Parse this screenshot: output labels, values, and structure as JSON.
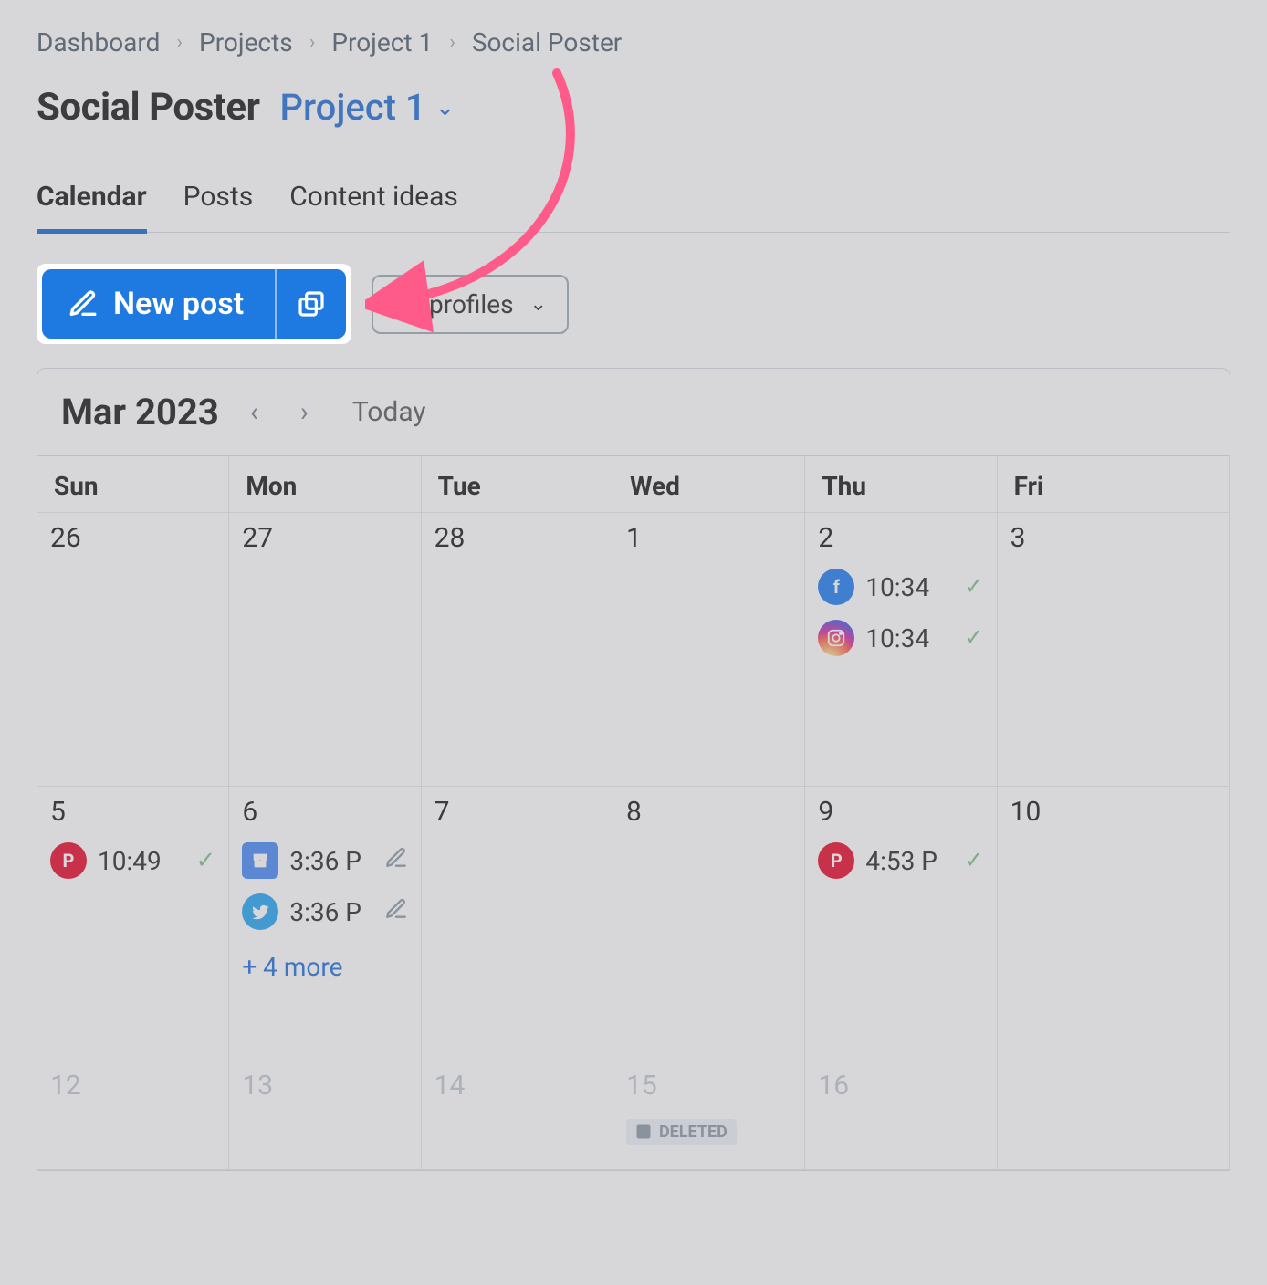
{
  "breadcrumb": {
    "items": [
      "Dashboard",
      "Projects",
      "Project 1",
      "Social Poster"
    ]
  },
  "header": {
    "title": "Social Poster",
    "project_selector_label": "Project 1"
  },
  "tabs": {
    "items": [
      "Calendar",
      "Posts",
      "Content ideas"
    ],
    "active_index": 0
  },
  "toolbar": {
    "new_post_label": "New post",
    "profiles_filter_label": "All profiles"
  },
  "calendar": {
    "month_label": "Mar 2023",
    "today_label": "Today",
    "day_headers": [
      "Sun",
      "Mon",
      "Tue",
      "Wed",
      "Thu",
      "Fri"
    ],
    "rows": [
      {
        "cells": [
          {
            "num": "26",
            "events": []
          },
          {
            "num": "27",
            "events": []
          },
          {
            "num": "28",
            "events": []
          },
          {
            "num": "1",
            "events": []
          },
          {
            "num": "2",
            "events": [
              {
                "network": "facebook",
                "time": "10:34",
                "status": "done"
              },
              {
                "network": "instagram",
                "time": "10:34",
                "status": "done"
              }
            ]
          },
          {
            "num": "3",
            "events": []
          }
        ]
      },
      {
        "cells": [
          {
            "num": "5",
            "events": [
              {
                "network": "pinterest",
                "time": "10:49",
                "status": "done"
              }
            ]
          },
          {
            "num": "6",
            "events": [
              {
                "network": "google-business",
                "time": "3:36 P",
                "status": "draft"
              },
              {
                "network": "twitter",
                "time": "3:36 P",
                "status": "draft"
              }
            ],
            "more": "+ 4 more"
          },
          {
            "num": "7",
            "events": []
          },
          {
            "num": "8",
            "events": []
          },
          {
            "num": "9",
            "events": [
              {
                "network": "pinterest",
                "time": "4:53 P",
                "status": "done"
              }
            ]
          },
          {
            "num": "10",
            "events": []
          }
        ]
      },
      {
        "cells": [
          {
            "num": "12"
          },
          {
            "num": "13"
          },
          {
            "num": "14"
          },
          {
            "num": "15",
            "deleted_label": "DELETED"
          },
          {
            "num": "16"
          },
          {
            "num": ""
          }
        ]
      }
    ]
  }
}
